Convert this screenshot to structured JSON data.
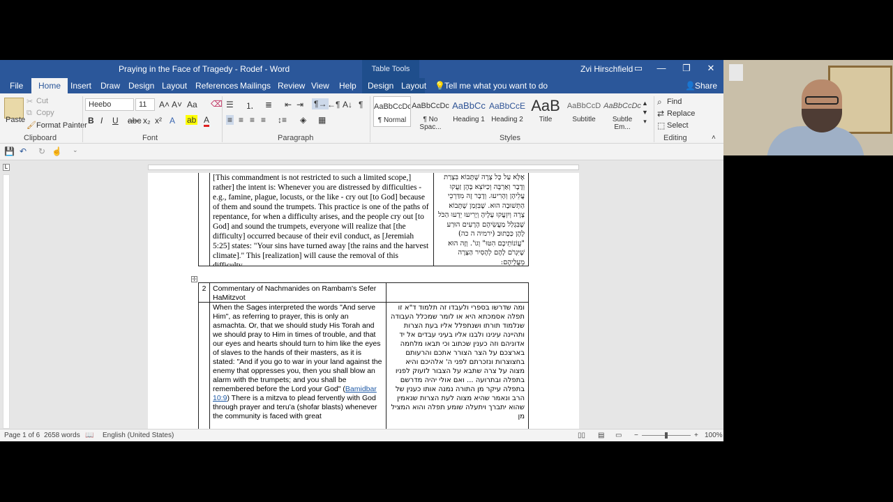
{
  "window": {
    "title": "Praying in the Face of Tragedy - Rodef  -  Word",
    "context_tab_group": "Table Tools",
    "user": "Zvi Hirschfield"
  },
  "tabs": [
    "File",
    "Home",
    "Insert",
    "Draw",
    "Design",
    "Layout",
    "References",
    "Mailings",
    "Review",
    "View",
    "Help",
    "Design",
    "Layout"
  ],
  "tell_me": "Tell me what you want to do",
  "share": "Share",
  "ribbon": {
    "clipboard": {
      "paste": "Paste",
      "cut": "Cut",
      "copy": "Copy",
      "format_painter": "Format Painter",
      "label": "Clipboard"
    },
    "font": {
      "name": "Heebo",
      "size": "11",
      "label": "Font"
    },
    "paragraph": {
      "label": "Paragraph"
    },
    "styles": {
      "label": "Styles",
      "items": [
        {
          "preview": "AaBbCcDc",
          "name": "¶ Normal"
        },
        {
          "preview": "AaBbCcDc",
          "name": "¶ No Spac..."
        },
        {
          "preview": "AaBbCc",
          "name": "Heading 1"
        },
        {
          "preview": "AaBbCcE",
          "name": "Heading 2"
        },
        {
          "preview": "AaB",
          "name": "Title"
        },
        {
          "preview": "AaBbCcD",
          "name": "Subtitle"
        },
        {
          "preview": "AaBbCcDc",
          "name": "Subtle Em..."
        }
      ]
    },
    "editing": {
      "find": "Find",
      "replace": "Replace",
      "select": "Select",
      "label": "Editing"
    }
  },
  "document": {
    "cell1_english": "[This commandment is not restricted to such a limited scope,] rather] the intent is: Whenever you are distressed by difficulties - e.g., famine, plague, locusts, or the like - cry out [to God] because of them and sound the trumpets. This practice is one of the paths of repentance, for when a difficulty arises, and the people cry out [to God] and sound the trumpets, everyone will realize that [the difficulty] occurred because of their evil conduct, as [Jeremiah 5:25] states: \"Your sins have turned away [the rains and the harvest climate].\" This [realization] will cause the removal of this difficulty.",
    "cell1_hebrew": "אֶלָּא עַל כָּל צָרָה שֶׁתָּבוֹא בִּצָרַת וְדֶבֶר וְאַרְבֶּה וְכַיּוֹצֵא בָּהֶן זַעֲקוּ עֲלֵיהֶן וְהָרִיעוּ. וְדָבָר זֶה מִדַּרְכֵי הַתְּשׁוּבָה הוּא. שֶׁבִּזְמַן שֶׁתָּבוֹא צָרָה וְיִזְעֲקוּ עָלֶיהָ וְיָרִיעוּ יֵדְעוּ הַכֹּל שֶׁבִּגְלַל מַעֲשֵׂיהֶם הָרָעִים הוּרַע לָהֶן כַּכָּתוּב (ירמיה ה כה) \"עֲוֹנוֹתֵיכֶם הִטּוּ\" וְגוֹ'. וְזֶה הוּא שֶׁיִּגְרֹם לָהֶם לְהָסִיר הַצָּרָה מֵעֲלֵיהֶם:",
    "row2_number": "2",
    "row2_title": "Commentary of Nachmanides on Rambam's Sefer HaMitzvot",
    "cell2_english_a": "When the Sages interpreted the words \"And serve Him\", as referring to prayer, this is only an asmachta.  Or, that we should study His Torah and we should pray to Him in times of trouble, and that our eyes and hearts should turn to him like the eyes of slaves to the hands of their masters, as it is stated: \"And if you go to war in your land against the enemy that oppresses you, then you shall blow an alarm with the trumpets; and you shall be remembered before the Lord your God\" (",
    "cell2_link": "Bamidbar 10:9",
    "cell2_english_b": ") There is a mitzva to plead fervently with God through prayer and teru'a (shofar blasts) whenever the community is faced with great",
    "cell2_hebrew": "ומה שדרשו בספרי ולעבדו זה תלמוד ד\"א זו תפלה אסמכתא היא או לומר שמכלל העבודה שנלמוד תורתו ושנתפלל אליו בעת הצרות ותהיינה עינינו ולבנו אליו בעיני עבדים אל יד אדוניהם וזה כענין שכתוב וכי תבאו מלחמה בארצכם על הצר הצורר אתכם והרעותם בחצוצרות ונזכרתם לפני ה' אלהיכם והיא מצוה על צרה שתבא על הצבור לזעוק לפניו בתפלה ובתרועה ... ואם אולי יהיה מדרשם בתפלה עיקר מן התורה נמנה אותו כענין של הרב ונאמר שהיא מצוה לעת הצרות שנאמין שהוא יתברך ויתעלה שומע תפלה והוא המציל מן"
  },
  "status": {
    "page": "Page 1 of 6",
    "words": "2658 words",
    "language": "English (United States)",
    "zoom": "100%"
  }
}
